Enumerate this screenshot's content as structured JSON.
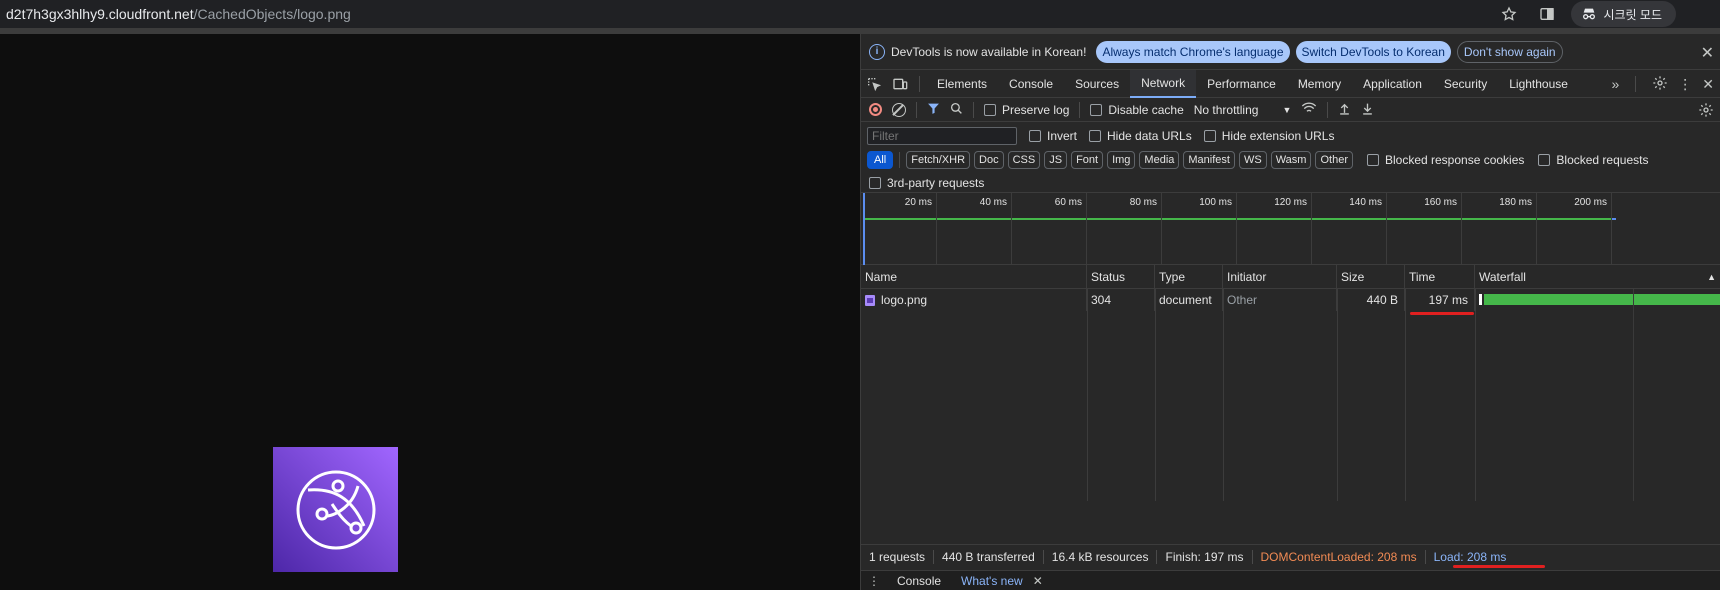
{
  "browser": {
    "url_host": "d2t7h3gx3hlhy9.cloudfront.net",
    "url_path": "/CachedObjects/logo.png",
    "bookmark_icon": "star-icon",
    "sidepanel_icon": "side-panel-icon",
    "incognito_label": "시크릿 모드"
  },
  "devtools": {
    "info_bar": {
      "message": "DevTools is now available in Korean!",
      "btn_always_match": "Always match Chrome's language",
      "btn_switch": "Switch DevTools to Korean",
      "btn_dont_show": "Don't show again",
      "close": "✕"
    },
    "tabs": [
      "Elements",
      "Console",
      "Sources",
      "Network",
      "Performance",
      "Memory",
      "Application",
      "Security",
      "Lighthouse"
    ],
    "active_tab": "Network",
    "more_tabs": "»",
    "toolbar": {
      "preserve_log": "Preserve log",
      "disable_cache": "Disable cache",
      "throttling": "No throttling"
    },
    "filter": {
      "placeholder": "Filter",
      "invert": "Invert",
      "hide_data_urls": "Hide data URLs",
      "hide_extension_urls": "Hide extension URLs",
      "types": [
        "All",
        "Fetch/XHR",
        "Doc",
        "CSS",
        "JS",
        "Font",
        "Img",
        "Media",
        "Manifest",
        "WS",
        "Wasm",
        "Other"
      ],
      "blocked_cookies": "Blocked response cookies",
      "blocked_requests": "Blocked requests",
      "third_party": "3rd-party requests"
    },
    "overview_ticks": [
      "20 ms",
      "40 ms",
      "60 ms",
      "80 ms",
      "100 ms",
      "120 ms",
      "140 ms",
      "160 ms",
      "180 ms",
      "200 ms"
    ],
    "table": {
      "columns": [
        "Name",
        "Status",
        "Type",
        "Initiator",
        "Size",
        "Time",
        "Waterfall"
      ],
      "rows": [
        {
          "name": "logo.png",
          "status": "304",
          "type": "document",
          "initiator": "Other",
          "size": "440 B",
          "time": "197 ms"
        }
      ]
    },
    "summary": {
      "requests": "1 requests",
      "transferred": "440 B transferred",
      "resources": "16.4 kB resources",
      "finish": "Finish: 197 ms",
      "dom_content_loaded": "DOMContentLoaded: 208 ms",
      "load": "Load: 208 ms"
    },
    "drawer": {
      "tabs": [
        "Console",
        "What's new"
      ],
      "close": "✕"
    }
  },
  "colors": {
    "logo_gradient_start": "#4d27a8",
    "logo_gradient_end": "#a166ff",
    "waterfall_green": "#45b74a",
    "dcl_orange": "#f28b54",
    "load_blue": "#8ab4f8",
    "highlight_red": "#e02020"
  }
}
